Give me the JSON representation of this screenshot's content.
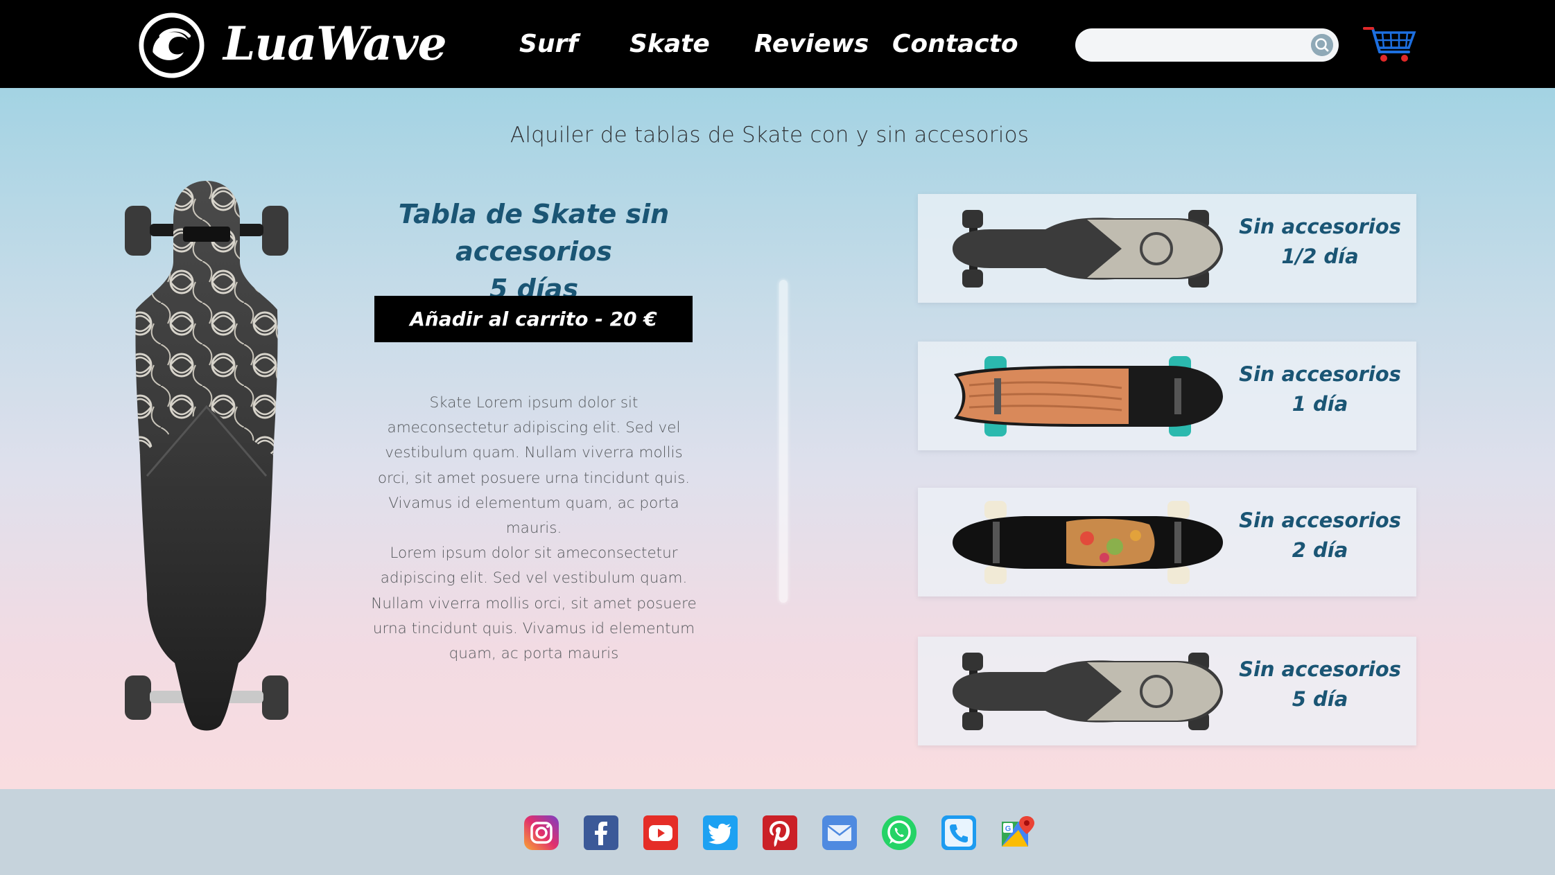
{
  "header": {
    "logo_text": "LuaWave",
    "nav": [
      {
        "label": "Surf"
      },
      {
        "label": "Skate"
      },
      {
        "label": "Reviews"
      },
      {
        "label": "Contacto"
      }
    ],
    "search": {
      "value": "",
      "placeholder": ""
    },
    "icons": {
      "logo": "wave-logo-icon",
      "search": "search-icon",
      "cart": "shopping-cart-icon"
    }
  },
  "main": {
    "heading": "Alquiler de tablas de Skate con y sin accesorios",
    "product": {
      "title_line1": "Tabla de Skate sin accesorios",
      "title_line2": "5 días",
      "add_to_cart": "Añadir al carrito - 20 €",
      "description": [
        "Skate Lorem ipsum dolor sit ameconsectetur adipiscing elit. Sed vel vestibulum quam. Nullam viverra mollis orci, sit amet posuere urna tincidunt quis. Vivamus id elementum quam, ac porta mauris.",
        "Lorem ipsum dolor sit ameconsectetur adipiscing elit. Sed vel vestibulum quam. Nullam viverra mollis orci, sit amet posuere urna tincidunt quis. Vivamus id elementum quam, ac porta mauris"
      ]
    },
    "options": [
      {
        "line1": "Sin accesorios",
        "line2": "1/2 día"
      },
      {
        "line1": "Sin accesorios",
        "line2": "1 día"
      },
      {
        "line1": "Sin accesorios",
        "line2": "2 día"
      },
      {
        "line1": "Sin accesorios",
        "line2": "5 día"
      }
    ]
  },
  "footer": {
    "social": [
      "instagram-icon",
      "facebook-icon",
      "youtube-icon",
      "twitter-icon",
      "pinterest-icon",
      "mail-icon",
      "whatsapp-icon",
      "phone-icon",
      "google-maps-icon"
    ]
  },
  "colors": {
    "header_bg": "#000000",
    "accent_text": "#1a5574",
    "button_bg": "#000000",
    "footer_bg": "#c6d3dc"
  }
}
